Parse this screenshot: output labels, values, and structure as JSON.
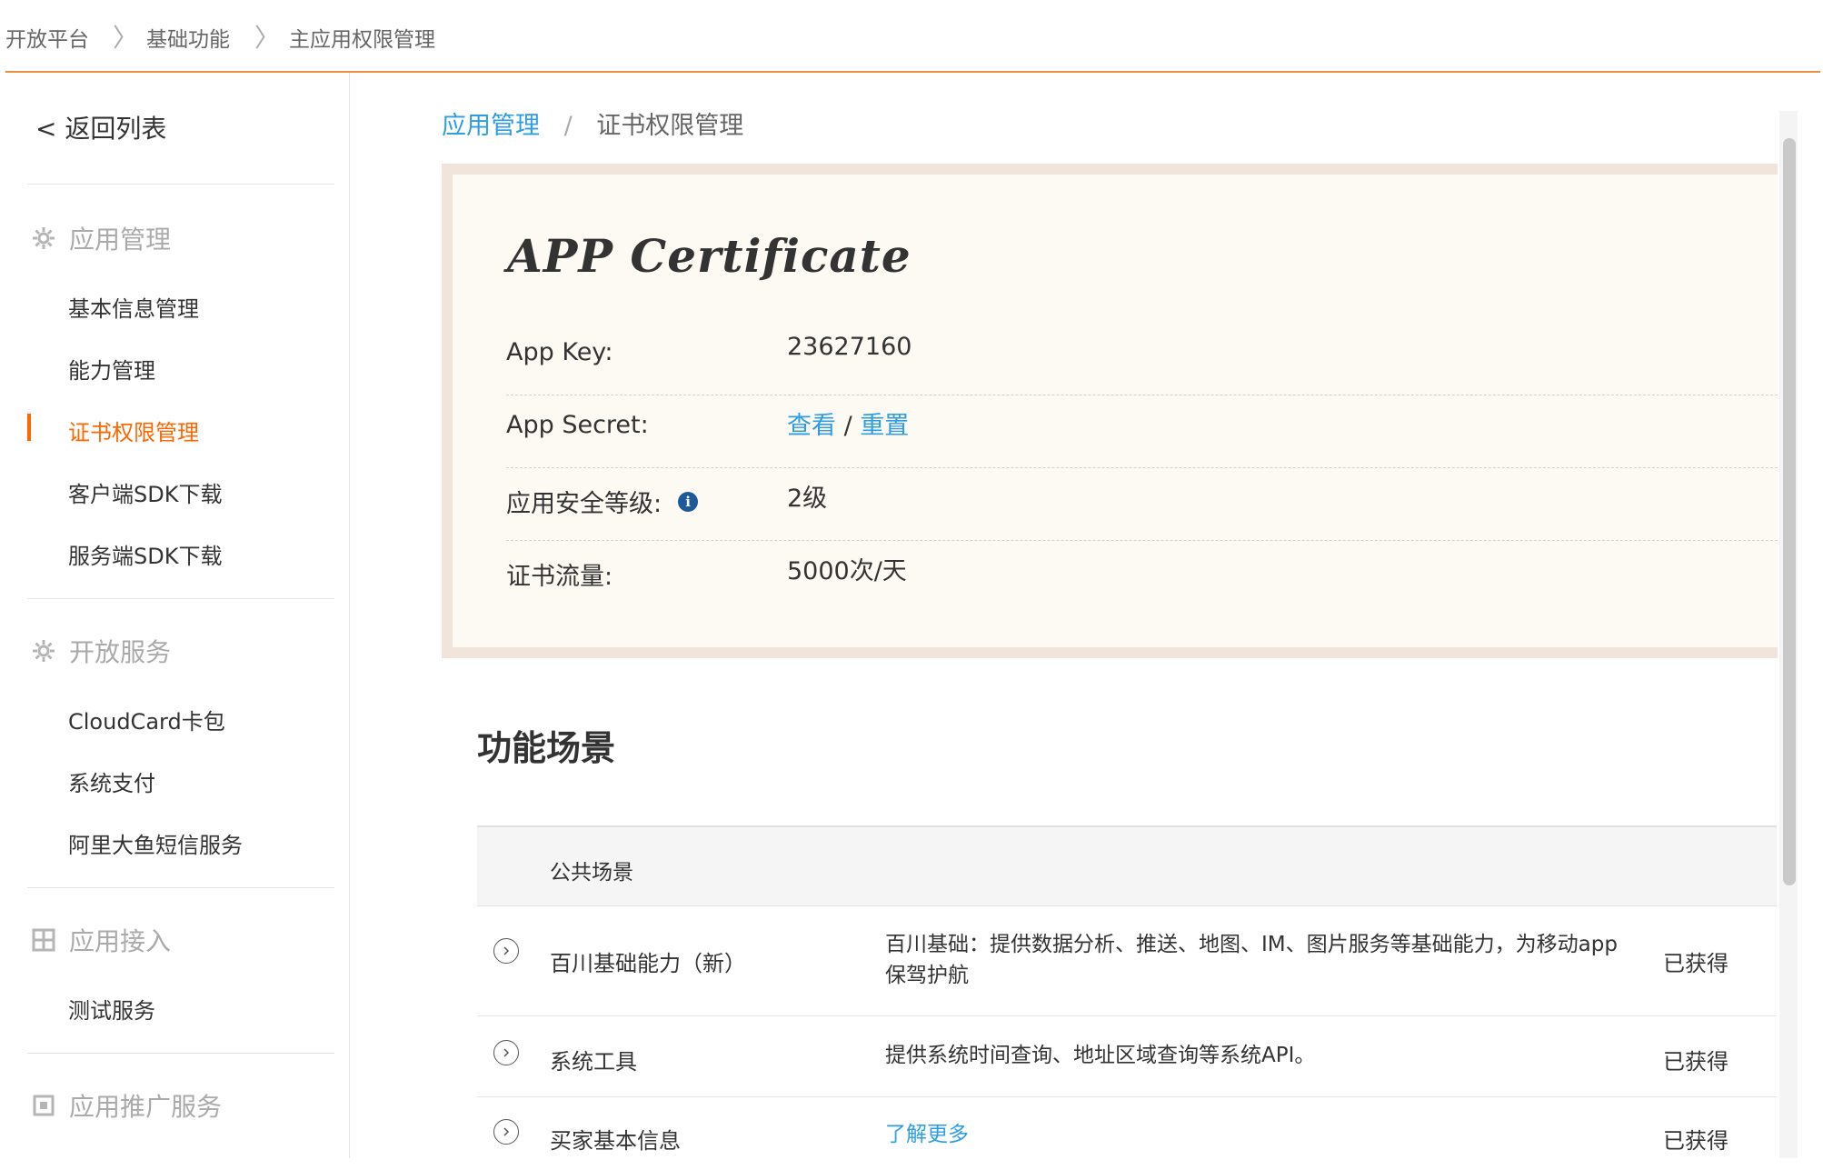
{
  "breadcrumb": {
    "items": [
      "开放平台",
      "基础功能",
      "主应用权限管理"
    ],
    "separator": "〉"
  },
  "sidebar": {
    "back_label": "< 返回列表",
    "sections": [
      {
        "label": "应用管理",
        "icon": "gear-icon",
        "items": [
          "基本信息管理",
          "能力管理",
          "证书权限管理",
          "客户端SDK下载",
          "服务端SDK下载"
        ]
      },
      {
        "label": "开放服务",
        "icon": "gear-icon",
        "items": [
          "CloudCard卡包",
          "系统支付",
          "阿里大鱼短信服务"
        ]
      },
      {
        "label": "应用接入",
        "icon": "grid-icon",
        "items": [
          "测试服务"
        ]
      },
      {
        "label": "应用推广服务",
        "icon": "square-icon",
        "items": []
      }
    ],
    "active_item": "证书权限管理"
  },
  "main": {
    "breadcrumb": {
      "link": "应用管理",
      "separator": "/",
      "current": "证书权限管理"
    },
    "certificate": {
      "title": "APP Certificate",
      "rows": [
        {
          "label": "App Key:",
          "value": "23627160"
        },
        {
          "label": "App Secret:",
          "view": "查看",
          "sep": "/",
          "reset": "重置"
        },
        {
          "label": "应用安全等级:",
          "value": "2级"
        },
        {
          "label": "证书流量:",
          "value": "5000次/天"
        }
      ]
    },
    "scenes": {
      "title": "功能场景",
      "header": "公共场景",
      "rows": [
        {
          "name": "百川基础能力（新）",
          "desc": "百川基础：提供数据分析、推送、地图、IM、图片服务等基础能力，为移动app保驾护航",
          "status": "已获得"
        },
        {
          "name": "系统工具",
          "desc": "提供系统时间查询、地址区域查询等系统API。",
          "status": "已获得"
        },
        {
          "name": "买家基本信息",
          "desc": "了解更多",
          "status": "已获得"
        }
      ]
    }
  },
  "colors": {
    "accent": "#ff6600",
    "link": "#2d9de4",
    "topline": "#f08c3c"
  }
}
